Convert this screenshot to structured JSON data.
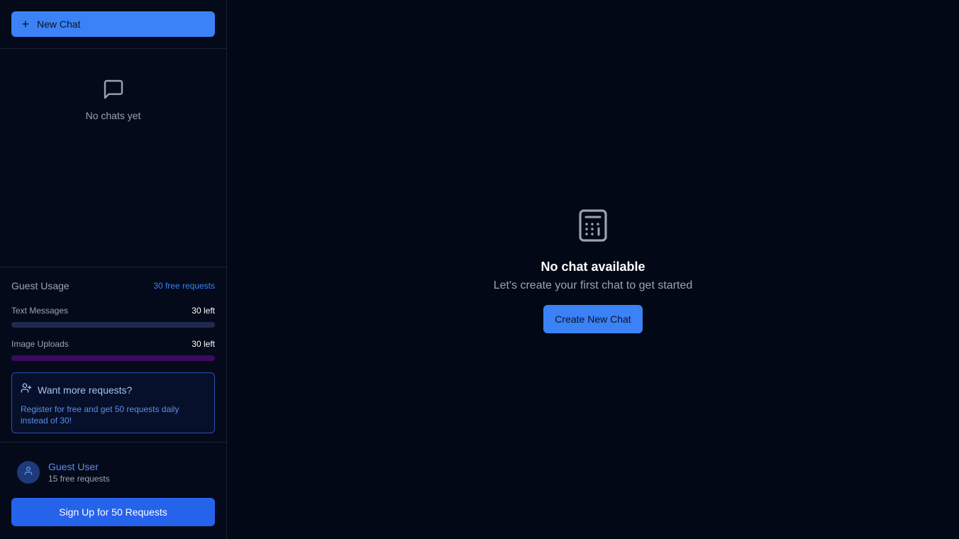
{
  "sidebar": {
    "new_chat_label": "New Chat",
    "empty_chats_text": "No chats yet",
    "usage": {
      "title": "Guest Usage",
      "badge": "30 free requests",
      "items": [
        {
          "label": "Text Messages",
          "left": "30 left",
          "fraction_used": 0
        },
        {
          "label": "Image Uploads",
          "left": "30 left",
          "fraction_used": 0
        }
      ]
    },
    "promo": {
      "title": "Want more requests?",
      "text": "Register for free and get 50 requests daily instead of 30!"
    },
    "user": {
      "name": "Guest User",
      "subtitle": "15 free requests"
    },
    "signup_label": "Sign Up for 50 Requests"
  },
  "main": {
    "icon": "calculator-icon",
    "title": "No chat available",
    "subtitle": "Let's create your first chat to get started",
    "create_label": "Create New Chat"
  },
  "colors": {
    "accent": "#3b82f6",
    "background": "#030816",
    "text_bar": "#1f2a4d",
    "image_bar": "#3b0a5e"
  }
}
